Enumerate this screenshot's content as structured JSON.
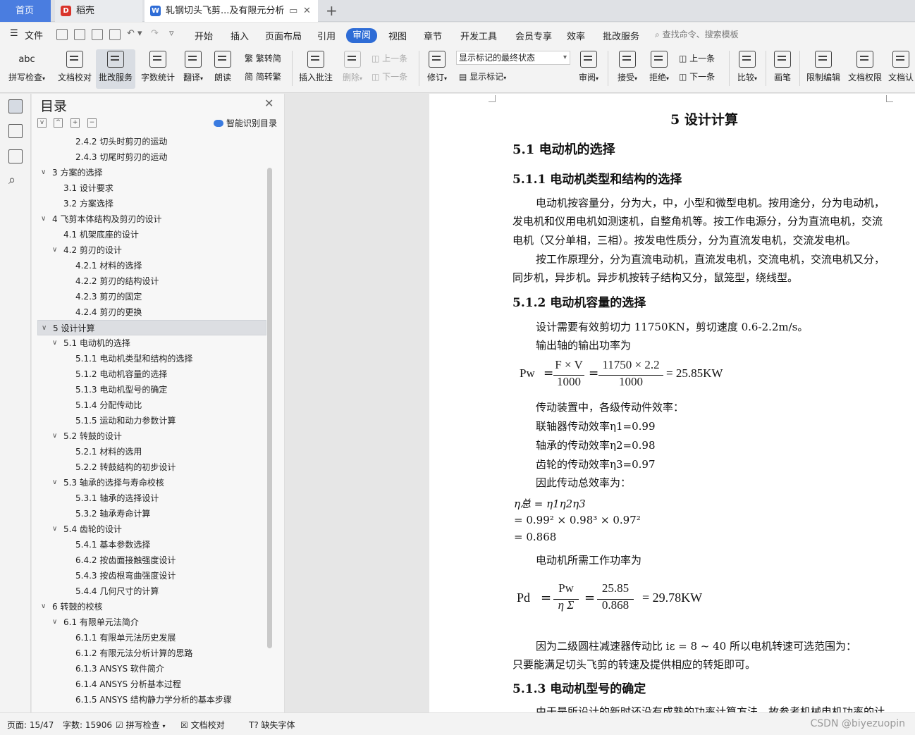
{
  "tabs": {
    "home": "首页",
    "daoke": "稻壳",
    "document": "轧钢切头飞剪...及有限元分析",
    "new_tab": "+"
  },
  "menu": {
    "file": "文件",
    "items": [
      "开始",
      "插入",
      "页面布局",
      "引用",
      "审阅",
      "视图",
      "章节",
      "开发工具",
      "会员专享",
      "效率",
      "批改服务"
    ],
    "active": "审阅",
    "search_placeholder": "查找命令、搜索模板"
  },
  "ribbon": {
    "spellcheck": "拼写检查",
    "doc_proof": "文档校对",
    "review_service": "批改服务",
    "word_count": "字数统计",
    "translate": "翻译",
    "read_aloud": "朗读",
    "to_traditional": "繁转简",
    "to_simplified": "简转繁",
    "insert_comment": "插入批注",
    "delete": "删除",
    "prev_comment": "上一条",
    "next_comment": "下一条",
    "track_changes": "修订",
    "markup_mode": "显示标记的最终状态",
    "show_markup": "显示标记",
    "review_pane": "审阅",
    "accept": "接受",
    "reject": "拒绝",
    "prev_change": "上一条",
    "next_change": "下一条",
    "compare": "比较",
    "pen": "画笔",
    "restrict_edit": "限制编辑",
    "doc_permission": "文档权限",
    "doc_cert": "文档认"
  },
  "toc": {
    "title": "目录",
    "smart_label": "智能识别目录",
    "items": [
      {
        "label": "2.4.2  切头时剪刃的运动",
        "level": 3,
        "caret": ""
      },
      {
        "label": "2.4.3  切尾时剪刃的运动",
        "level": 3,
        "caret": ""
      },
      {
        "label": "3  方案的选择",
        "level": 1,
        "caret": "v"
      },
      {
        "label": "3.1  设计要求",
        "level": 2,
        "caret": ""
      },
      {
        "label": "3.2  方案选择",
        "level": 2,
        "caret": ""
      },
      {
        "label": "4 飞剪本体结构及剪刃的设计",
        "level": 1,
        "caret": "v"
      },
      {
        "label": "4.1 机架底座的设计",
        "level": 2,
        "caret": ""
      },
      {
        "label": "4.2 剪刃的设计",
        "level": 2,
        "caret": "v"
      },
      {
        "label": "4.2.1 材料的选择",
        "level": 3,
        "caret": ""
      },
      {
        "label": "4.2.2 剪刃的结构设计",
        "level": 3,
        "caret": ""
      },
      {
        "label": "4.2.3 剪刃的固定",
        "level": 3,
        "caret": ""
      },
      {
        "label": "4.2.4  剪刃的更换",
        "level": 3,
        "caret": ""
      },
      {
        "label": "5  设计计算",
        "level": 1,
        "caret": "v",
        "selected": true
      },
      {
        "label": "5.1 电动机的选择",
        "level": 2,
        "caret": "v"
      },
      {
        "label": "5.1.1 电动机类型和结构的选择",
        "level": 3,
        "caret": ""
      },
      {
        "label": "5.1.2  电动机容量的选择",
        "level": 3,
        "caret": ""
      },
      {
        "label": "5.1.3  电动机型号的确定",
        "level": 3,
        "caret": ""
      },
      {
        "label": "5.1.4  分配传动比",
        "level": 3,
        "caret": ""
      },
      {
        "label": "5.1.5  运动和动力参数计算",
        "level": 3,
        "caret": ""
      },
      {
        "label": "5.2  转鼓的设计",
        "level": 2,
        "caret": "v"
      },
      {
        "label": "5.2.1  材料的选用",
        "level": 3,
        "caret": ""
      },
      {
        "label": "5.2.2  转鼓结构的初步设计",
        "level": 3,
        "caret": ""
      },
      {
        "label": "5.3 轴承的选择与寿命校核",
        "level": 2,
        "caret": "v"
      },
      {
        "label": "5.3.1  轴承的选择设计",
        "level": 3,
        "caret": ""
      },
      {
        "label": "5.3.2  轴承寿命计算",
        "level": 3,
        "caret": ""
      },
      {
        "label": "5.4  齿轮的设计",
        "level": 2,
        "caret": "v"
      },
      {
        "label": "5.4.1  基本参数选择",
        "level": 3,
        "caret": ""
      },
      {
        "label": "6.4.2  按齿面接触强度设计",
        "level": 3,
        "caret": ""
      },
      {
        "label": "5.4.3 按齿根弯曲强度设计",
        "level": 3,
        "caret": ""
      },
      {
        "label": "5.4.4  几何尺寸的计算",
        "level": 3,
        "caret": ""
      },
      {
        "label": "6  转鼓的校核",
        "level": 1,
        "caret": "v"
      },
      {
        "label": "6.1 有限单元法简介",
        "level": 2,
        "caret": "v"
      },
      {
        "label": "6.1.1  有限单元法历史发展",
        "level": 3,
        "caret": ""
      },
      {
        "label": "6.1.2 有限元法分析计算的思路",
        "level": 3,
        "caret": ""
      },
      {
        "label": "6.1.3    ANSYS 软件简介",
        "level": 3,
        "caret": ""
      },
      {
        "label": "6.1.4    ANSYS 分析基本过程",
        "level": 3,
        "caret": ""
      },
      {
        "label": "6.1.5 ANSYS 结构静力学分析的基本步骤",
        "level": 3,
        "caret": ""
      }
    ]
  },
  "document": {
    "chapter_title": "5  设计计算",
    "h_5_1": "5.1 电动机的选择",
    "h_5_1_1": "5.1.1 电动机类型和结构的选择",
    "para1_l1": "电动机按容量分，分为大，中，小型和微型电机。按用途分，分为电动机，",
    "para1_l2": "发电机和仪用电机如测速机，自整角机等。按工作电源分，分为直流电机，交流",
    "para1_l3": "电机（又分单相，三相）。按发电性质分，分为直流发电机，交流发电机。",
    "para2_l1": "按工作原理分，分为直流电动机，直流发电机，交流电机，交流电机又分，",
    "para2_l2": "同步机，异步机。异步机按转子结构又分，鼠笼型，绕线型。",
    "h_5_1_2": "5.1.2  电动机容量的选择",
    "req_line": "设计需要有效剪切力 11750KN，剪切速度 0.6-2.2m/s。",
    "out_power": "输出轴的输出功率为",
    "pw_label": "Pw",
    "pw_num1": "F × V",
    "pw_den1": "1000",
    "pw_num2": "11750 × 2.2",
    "pw_den2": "1000",
    "pw_result": "= 25.85KW",
    "eff_intro": "传动装置中，各级传动件效率：",
    "eff1": "联轴器传动效率η1=0.99",
    "eff2": "轴承的传动效率η2=0.98",
    "eff3": "齿轮的传动效率η3=0.97",
    "total_eff_intro": "因此传动总效率为：",
    "eta_line1": "η总 = η1η2η3",
    "eta_line2": "= 0.99² × 0.98³ × 0.97²",
    "eta_line3": "= 0.868",
    "motor_power_intro": "电动机所需工作功率为",
    "pd_label": "Pd",
    "pd_num1": "Pw",
    "pd_den1": "η Σ",
    "pd_num2": "25.85",
    "pd_den2": "0.868",
    "pd_result": "=  29.78KW",
    "ratio_line": "因为二级圆柱减速器传动比 iε = 8 ~ 40 所以电机转速可选范围为：",
    "ratio_line2": "只要能满足切头飞剪的转速及提供相应的转矩即可。",
    "h_5_1_3": "5.1.3  电动机型号的确定",
    "last_line": "由于是所设计的新时还没有成熟的功率计算方法，故参考机械电机功率的计"
  },
  "status": {
    "page": "页面: 15/47",
    "words": "字数: 15906",
    "spellcheck": "拼写检查",
    "proof": "文档校对",
    "missing_font": "缺失字体",
    "watermark": "CSDN @biyezuopin"
  },
  "colors": {
    "accent": "#2e6cd6",
    "home_tab": "#4a7de0"
  }
}
